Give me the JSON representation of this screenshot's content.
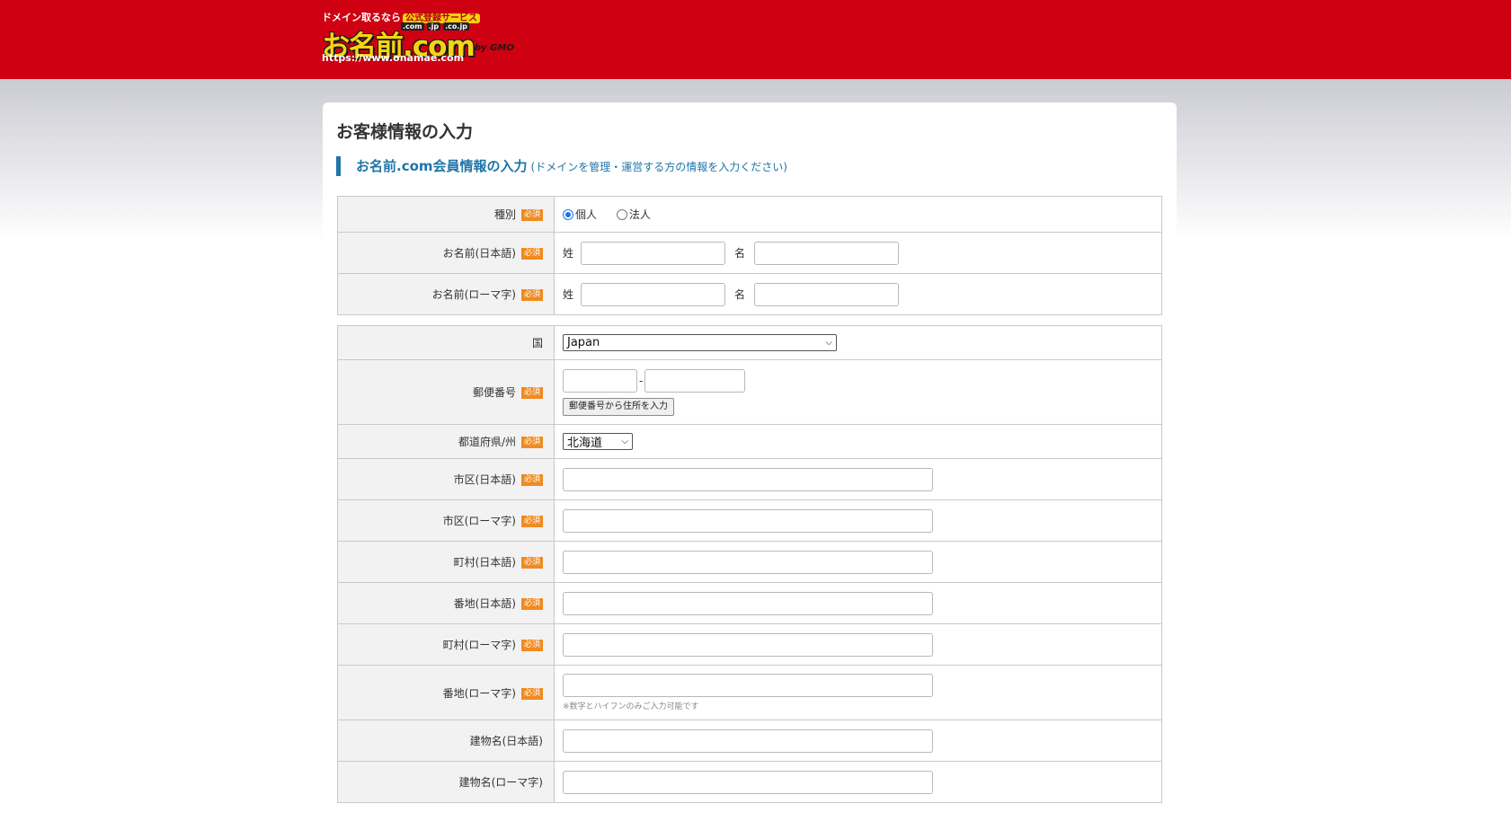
{
  "header": {
    "tagline": "ドメイン取るなら",
    "badge": "公式登録サービス",
    "tlds": [
      ".com",
      ".jp",
      ".co.jp"
    ],
    "logo_text": "お名前.com",
    "by_gmo": "by GMO",
    "url": "https://www.onamae.com"
  },
  "page": {
    "title": "お客様情報の入力",
    "section_title": "お名前.com会員情報の入力",
    "section_note": "(ドメインを管理・運営する方の情報を入力ください)"
  },
  "required_badge": "必須",
  "form1": {
    "type_label": "種別",
    "type_options": [
      "個人",
      "法人"
    ],
    "type_selected": "個人",
    "name_jp_label": "お名前(日本語)",
    "name_roman_label": "お名前(ローマ字)",
    "sei": "姓",
    "mei": "名"
  },
  "form2": {
    "country_label": "国",
    "country_value": "Japan",
    "postal_label": "郵便番号",
    "postal_separator": "-",
    "postal_button": "郵便番号から住所を入力",
    "pref_label": "都道府県/州",
    "pref_value": "北海道",
    "city_jp_label": "市区(日本語)",
    "city_roman_label": "市区(ローマ字)",
    "town_jp_label": "町村(日本語)",
    "banchi_jp_label": "番地(日本語)",
    "town_roman_label": "町村(ローマ字)",
    "banchi_roman_label": "番地(ローマ字)",
    "banchi_roman_note": "※数字とハイフンのみご入力可能です",
    "building_jp_label": "建物名(日本語)",
    "building_roman_label": "建物名(ローマ字)"
  },
  "colors": {
    "header_red": "#cf0012",
    "accent_blue": "#1f74a8",
    "required_orange": "#f08a21"
  }
}
